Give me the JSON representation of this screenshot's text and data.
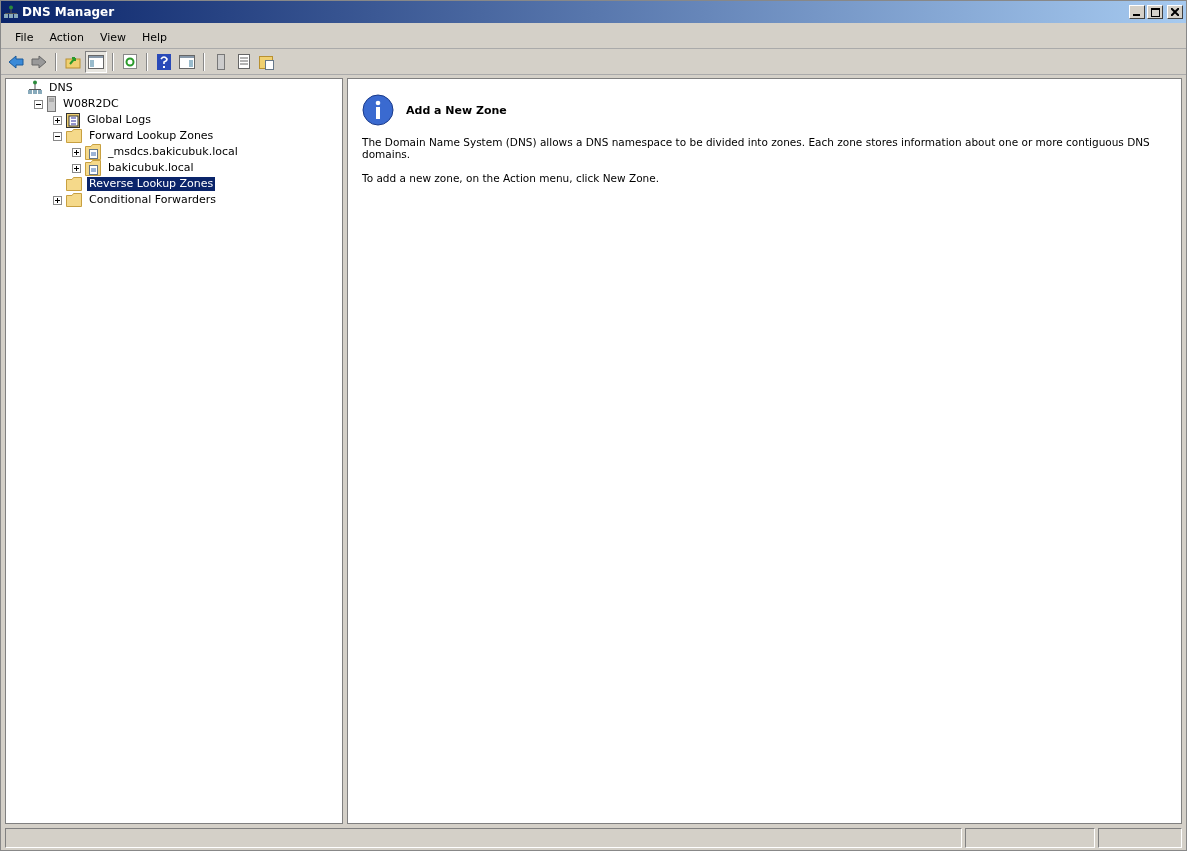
{
  "window": {
    "title": "DNS Manager"
  },
  "menu": [
    "File",
    "Action",
    "View",
    "Help"
  ],
  "toolbar": [
    {
      "kind": "back",
      "pressed": false
    },
    {
      "kind": "forward",
      "pressed": false
    },
    {
      "kind": "sep"
    },
    {
      "kind": "up",
      "pressed": false
    },
    {
      "kind": "tree",
      "pressed": true
    },
    {
      "kind": "sep"
    },
    {
      "kind": "refresh",
      "pressed": false
    },
    {
      "kind": "sep"
    },
    {
      "kind": "help",
      "pressed": false
    },
    {
      "kind": "pane",
      "pressed": false
    },
    {
      "kind": "sep"
    },
    {
      "kind": "server",
      "pressed": false
    },
    {
      "kind": "list",
      "pressed": false
    },
    {
      "kind": "zone",
      "pressed": false
    }
  ],
  "tree": [
    {
      "label": "DNS",
      "kind": "dns",
      "selected": false,
      "children": [
        {
          "label": "W08R2DC",
          "kind": "server",
          "expanded": true,
          "selected": false,
          "children": [
            {
              "label": "Global Logs",
              "kind": "log",
              "expanded": false,
              "selected": false
            },
            {
              "label": "Forward Lookup Zones",
              "kind": "folder",
              "expanded": true,
              "selected": false,
              "children": [
                {
                  "label": "_msdcs.bakicubuk.local",
                  "kind": "zone",
                  "expanded": false,
                  "selected": false
                },
                {
                  "label": "bakicubuk.local",
                  "kind": "zone",
                  "expanded": false,
                  "selected": false
                }
              ]
            },
            {
              "label": "Reverse Lookup Zones",
              "kind": "folder",
              "selected": true
            },
            {
              "label": "Conditional Forwarders",
              "kind": "folder",
              "expanded": false,
              "selected": false
            }
          ]
        }
      ]
    }
  ],
  "content": {
    "heading": "Add a New Zone",
    "paragraphs": [
      "The Domain Name System (DNS) allows a DNS namespace to be divided into zones. Each zone stores information about one or more contiguous DNS domains.",
      "To add a new zone, on the Action menu, click New Zone."
    ]
  }
}
